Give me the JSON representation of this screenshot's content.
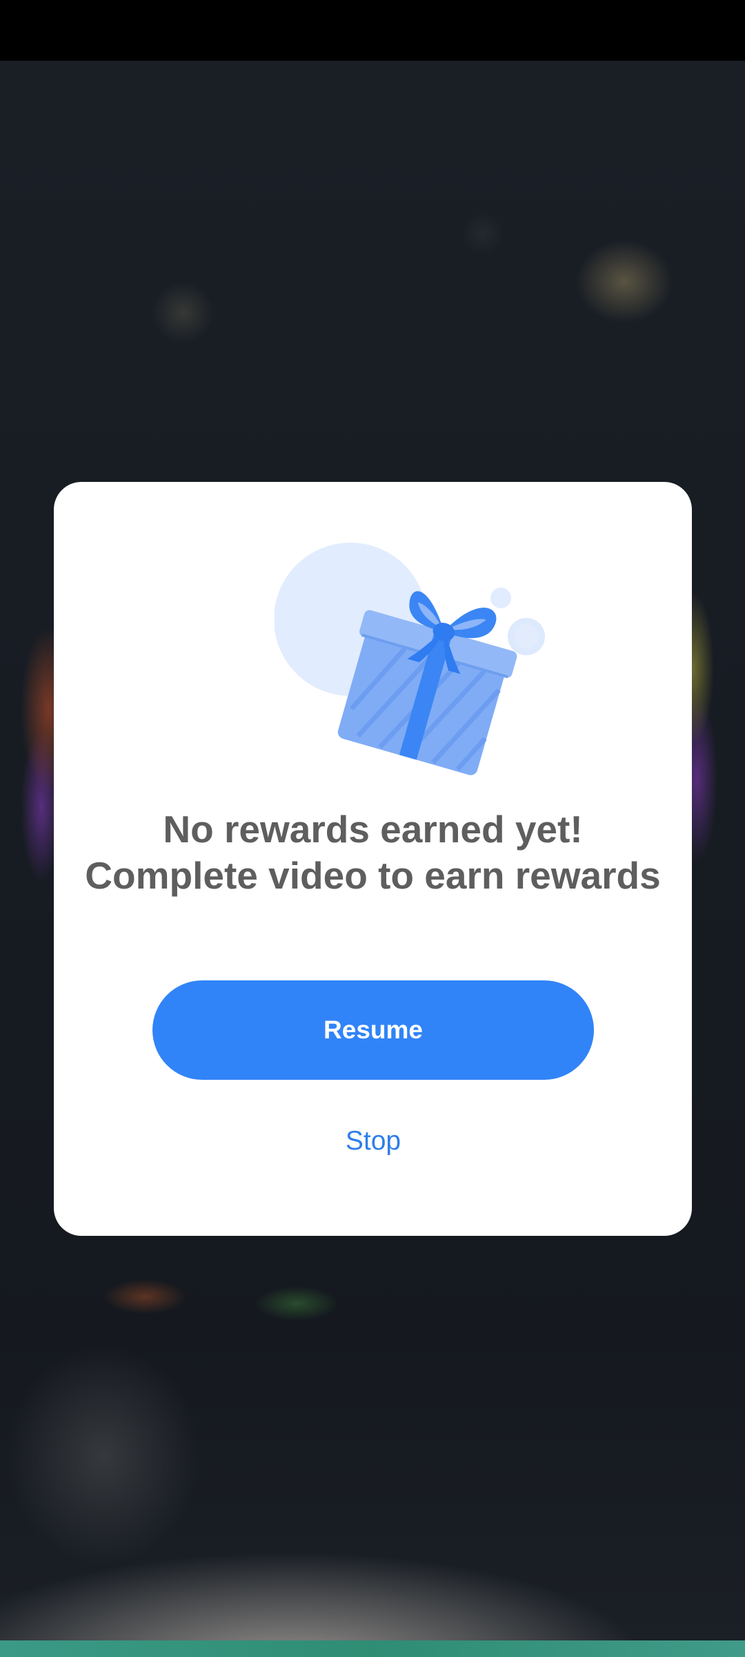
{
  "dialog": {
    "illustration_icon": "gift-icon",
    "title": "No rewards earned yet! Complete video to earn rewards",
    "primary_button_label": "Resume",
    "secondary_link_label": "Stop"
  },
  "colors": {
    "accent": "#3184f8",
    "link": "#2f7fe9",
    "title_text": "#5e5e5e",
    "dialog_bg": "#ffffff",
    "backdrop": "#161b22",
    "status_bar": "#000000"
  }
}
